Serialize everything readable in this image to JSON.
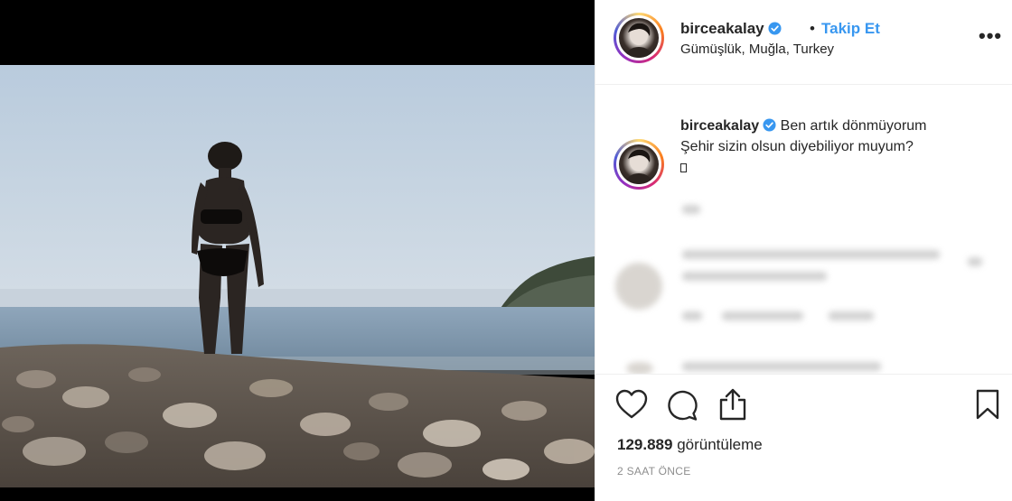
{
  "post": {
    "username": "birceakalay",
    "separator": "•",
    "follow_label": "Takip Et",
    "location": "Gümüşlük, Muğla, Turkey",
    "more_label": "•••"
  },
  "caption": {
    "username": "birceakalay",
    "line1": "Ben artık dönmüyorum",
    "line2": "Şehir sizin olsun diyebiliyor muyum?"
  },
  "stats": {
    "views_count": "129.889",
    "views_label": "görüntüleme",
    "time_ago": "2 SAAT ÖNCE"
  },
  "icons": {
    "like": "heart-icon",
    "comment": "comment-icon",
    "share": "share-icon",
    "save": "bookmark-icon",
    "verified": "verified-badge-icon"
  },
  "colors": {
    "link": "#3897f0",
    "text": "#262626",
    "muted": "#8e8e8e",
    "verified": "#3897f0"
  }
}
